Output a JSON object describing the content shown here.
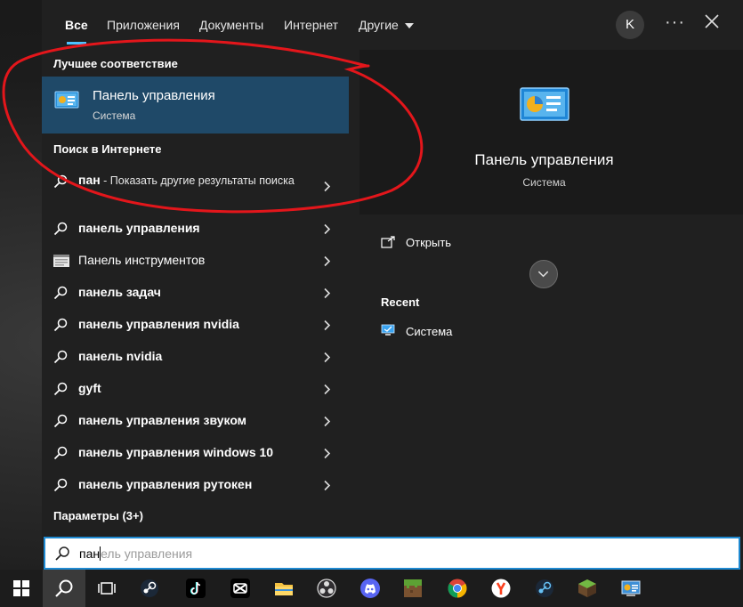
{
  "tabs": [
    {
      "label": "Все",
      "active": true
    },
    {
      "label": "Приложения"
    },
    {
      "label": "Документы"
    },
    {
      "label": "Интернет"
    },
    {
      "label": "Другие"
    }
  ],
  "account": {
    "initial": "K"
  },
  "more_label": "···",
  "best_match": {
    "heading": "Лучшее соответствие",
    "title": "Панель управления",
    "subtitle": "Система"
  },
  "web_search": {
    "heading": "Поиск в Интернете",
    "query": "пан",
    "suffix": " - Показать другие результаты поиска"
  },
  "suggestions": [
    {
      "text": "панель управления",
      "icon": "search-icon"
    },
    {
      "text": "Панель инструментов",
      "icon": "toolbar-app-icon"
    },
    {
      "text": "панель задач",
      "icon": "search-icon"
    },
    {
      "text": "панель управления nvidia",
      "icon": "search-icon"
    },
    {
      "text": "панель nvidia",
      "icon": "search-icon"
    },
    {
      "text": "gyft",
      "icon": "search-icon"
    },
    {
      "text": "панель управления звуком",
      "icon": "search-icon"
    },
    {
      "text": "панель управления windows 10",
      "icon": "search-icon"
    },
    {
      "text": "панель управления рутокен",
      "icon": "search-icon"
    }
  ],
  "settings_heading": "Параметры (3+)",
  "detail": {
    "title": "Панель управления",
    "subtitle": "Система",
    "open_label": "Открыть",
    "recent_heading": "Recent",
    "recent_items": [
      "Система"
    ]
  },
  "search_box": {
    "typed": "пан",
    "hint": "ель управления"
  },
  "taskbar_apps": [
    "start-icon",
    "search-icon",
    "task-view-icon",
    "steam-icon",
    "tiktok-icon",
    "capcut-icon",
    "file-explorer-icon",
    "obs-icon",
    "discord-icon",
    "minecraft-icon",
    "chrome-icon",
    "yandex-browser-icon",
    "steam-icon",
    "minecraft-launcher-icon",
    "control-panel-icon"
  ],
  "colors": {
    "accent": "#4cc2ff",
    "selection": "#1f4968",
    "annotation": "#e3161b",
    "search_border": "#1f8ad2"
  }
}
